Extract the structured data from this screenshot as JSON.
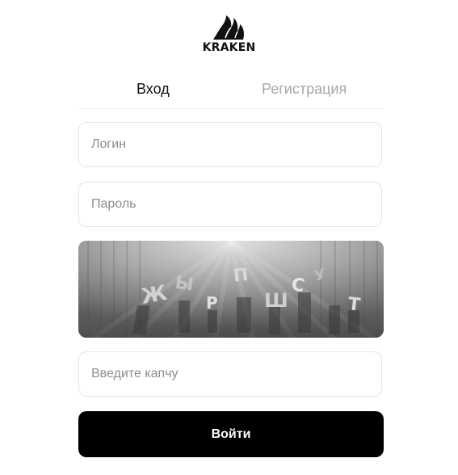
{
  "brand": {
    "logo_text": "KRAKEN",
    "logo_icon": "kraken-logo-icon"
  },
  "tabs": {
    "login": "Вход",
    "register": "Регистрация"
  },
  "form": {
    "login_placeholder": "Логин",
    "password_placeholder": "Пароль",
    "captcha_placeholder": "Введите капчу",
    "submit_label": "Войти"
  },
  "captcha": {
    "letters": [
      "Ж",
      "Ы",
      "Р",
      "П",
      "Ш",
      "С",
      "У",
      "Т"
    ]
  },
  "colors": {
    "button_bg": "#000000",
    "button_text": "#ffffff",
    "inactive_tab": "#a8a8a8",
    "active_tab": "#141414",
    "field_border": "#e5e5e5"
  }
}
